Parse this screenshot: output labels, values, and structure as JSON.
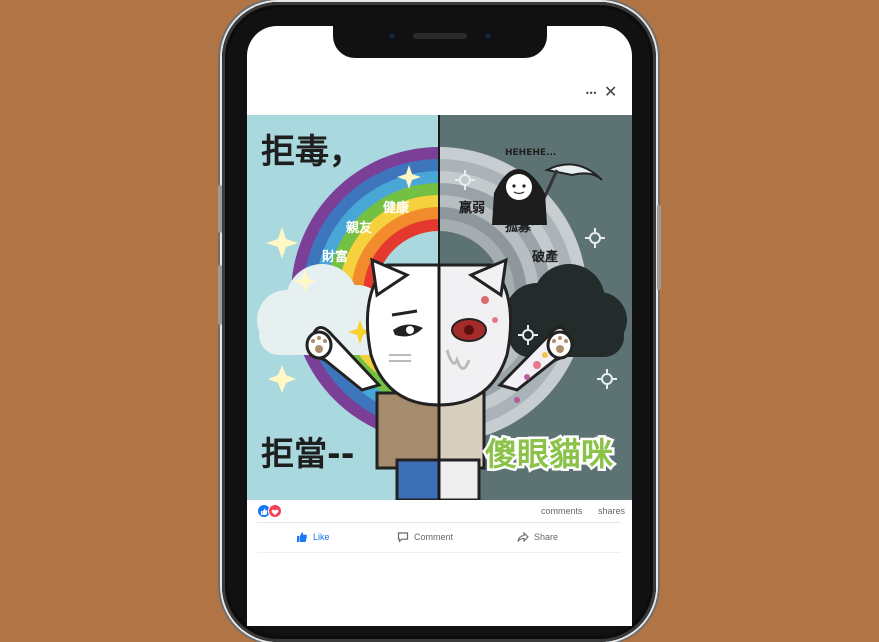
{
  "post_menu": {
    "more_icon": "more-dots-icon",
    "more_glyph": "•••",
    "close_icon": "close-icon",
    "close_glyph": "✕"
  },
  "post_image": {
    "headline_top": "拒毒，",
    "headline_bottom": "拒當--",
    "headline_highlight": "傻眼貓咪",
    "laugh": "HEHEHE...",
    "good_words": [
      "健康",
      "親友",
      "財富"
    ],
    "bad_words": [
      "羸弱",
      "孤寡",
      "破產"
    ]
  },
  "counts": {
    "reaction_icons": [
      "like-reaction-icon",
      "love-reaction-icon"
    ],
    "comments_label": "comments",
    "shares_label": "shares"
  },
  "actions": {
    "like_label": "Like",
    "comment_label": "Comment",
    "share_label": "Share"
  },
  "colors": {
    "background": "#b17444",
    "like_blue": "#1877f2",
    "love_red": "#f33e58",
    "headline_green": "#8bc34a",
    "sky_left": "#a9d8de",
    "sky_right": "#5d7373"
  }
}
